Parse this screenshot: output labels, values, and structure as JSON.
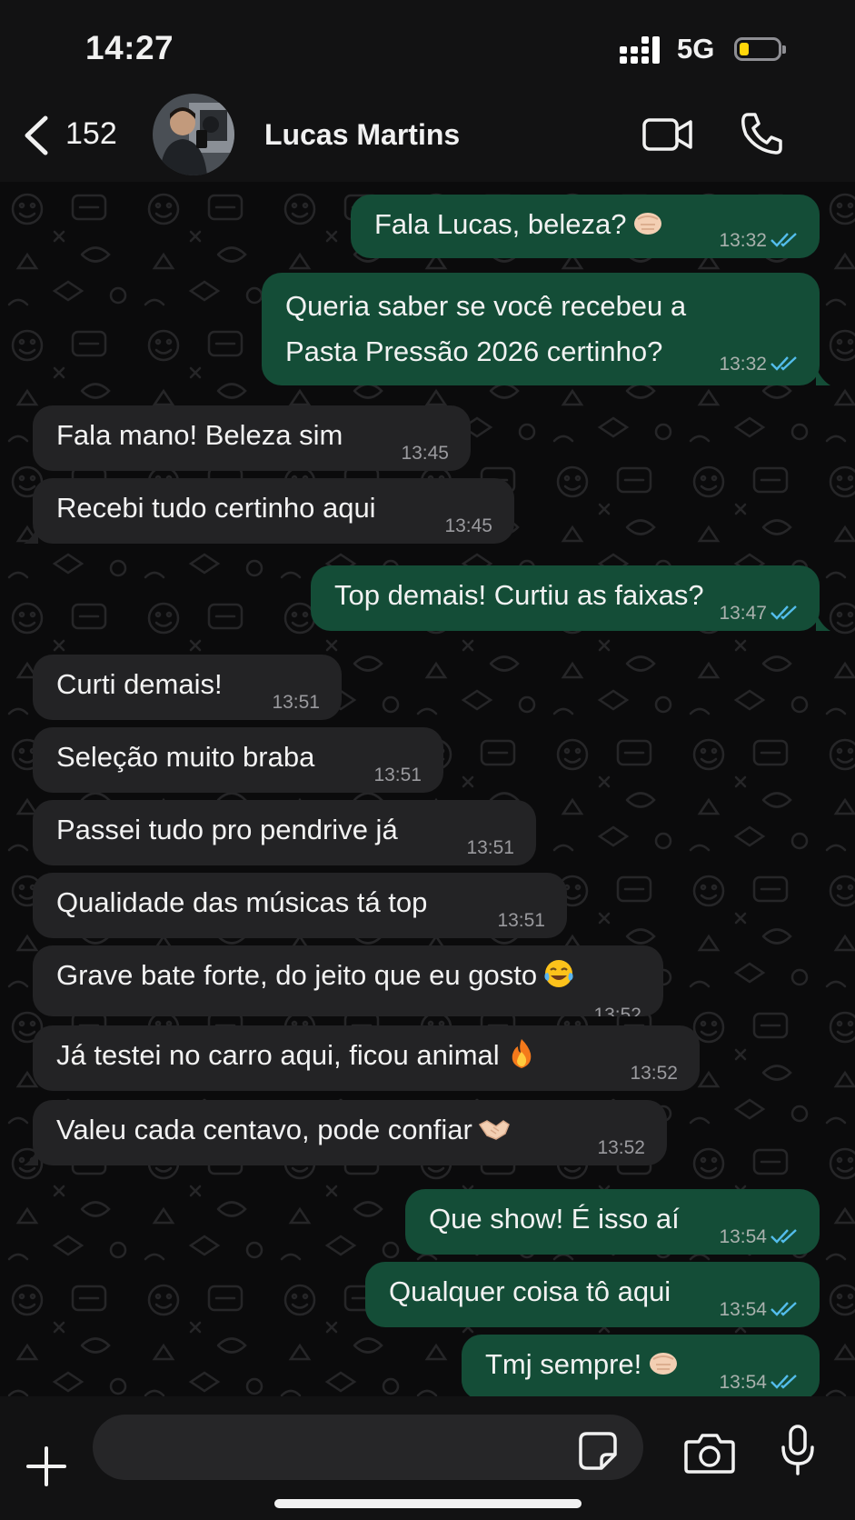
{
  "status_bar": {
    "time": "14:27",
    "network": "5G",
    "battery_level": 0.25
  },
  "header": {
    "back_count": "152",
    "contact_name": "Lucas Martins"
  },
  "messages": [
    {
      "dir": "out",
      "text": "Fala Lucas, beleza?",
      "emoji": "fist-bump",
      "time": "13:32",
      "read": true
    },
    {
      "dir": "out",
      "text": "Queria saber se você recebeu a\nPasta Pressão 2026 certinho?",
      "time": "13:32",
      "read": true
    },
    {
      "dir": "in",
      "text": "Fala mano! Beleza sim",
      "time": "13:45"
    },
    {
      "dir": "in",
      "text": "Recebi tudo certinho aqui",
      "time": "13:45"
    },
    {
      "dir": "out",
      "text": "Top demais! Curtiu as faixas?",
      "time": "13:47",
      "read": true
    },
    {
      "dir": "in",
      "text": "Curti demais!",
      "time": "13:51"
    },
    {
      "dir": "in",
      "text": "Seleção muito braba",
      "time": "13:51"
    },
    {
      "dir": "in",
      "text": "Passei tudo pro pendrive já",
      "time": "13:51"
    },
    {
      "dir": "in",
      "text": "Qualidade das músicas tá top",
      "time": "13:51"
    },
    {
      "dir": "in",
      "text": "Grave bate forte, do jeito que eu gosto",
      "emoji": "tears-of-joy",
      "time": "13:52"
    },
    {
      "dir": "in",
      "text": "Já testei no carro aqui, ficou animal",
      "emoji": "fire",
      "time": "13:52"
    },
    {
      "dir": "in",
      "text": "Valeu cada centavo, pode confiar",
      "emoji": "handshake",
      "time": "13:52"
    },
    {
      "dir": "out",
      "text": "Que show! É isso aí",
      "time": "13:54",
      "read": true
    },
    {
      "dir": "out",
      "text": "Qualquer coisa tô aqui",
      "time": "13:54",
      "read": true
    },
    {
      "dir": "out",
      "text": "Tmj sempre!",
      "emoji": "fist-bump",
      "time": "13:54",
      "read": true
    }
  ],
  "composer": {
    "value": ""
  },
  "colors": {
    "outgoing_bubble": "#144d37",
    "incoming_bubble": "#232325",
    "read_ticks": "#53bdeb",
    "background": "#0b0b0c"
  }
}
